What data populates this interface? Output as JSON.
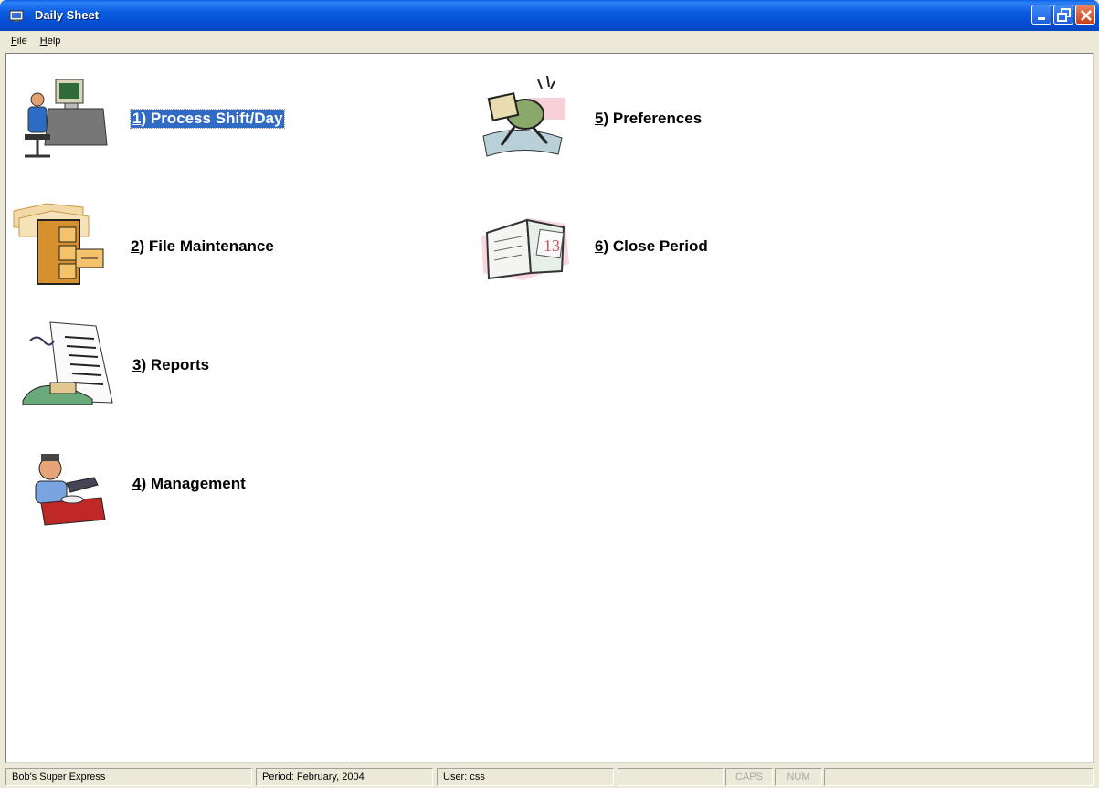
{
  "window": {
    "title": "Daily Sheet",
    "controls": {
      "minimize": "minimize-icon",
      "restore": "restore-icon",
      "close": "close-icon"
    }
  },
  "menu": [
    {
      "key": "F",
      "rest": "ile"
    },
    {
      "key": "H",
      "rest": "elp"
    }
  ],
  "tiles": [
    {
      "num": "1",
      "rest": ") Process Shift/Day",
      "icon": "computer-user-icon",
      "selected": true
    },
    {
      "num": "2",
      "rest": ") File Maintenance",
      "icon": "file-cabinet-icon",
      "selected": false
    },
    {
      "num": "3",
      "rest": ") Reports",
      "icon": "reports-icon",
      "selected": false
    },
    {
      "num": "4",
      "rest": ") Management",
      "icon": "manager-icon",
      "selected": false
    },
    {
      "num": "5",
      "rest": ") Preferences",
      "icon": "preferences-icon",
      "selected": false
    },
    {
      "num": "6",
      "rest": ") Close Period",
      "icon": "calendar-icon",
      "selected": false
    }
  ],
  "status": {
    "company": "Bob's Super Express",
    "period": "Period: February, 2004",
    "user": "User: css",
    "caps": "CAPS",
    "num": "NUM"
  },
  "colors": {
    "titlebar": "#0550d4",
    "selection": "#316ac5",
    "chrome": "#ece9d8"
  }
}
